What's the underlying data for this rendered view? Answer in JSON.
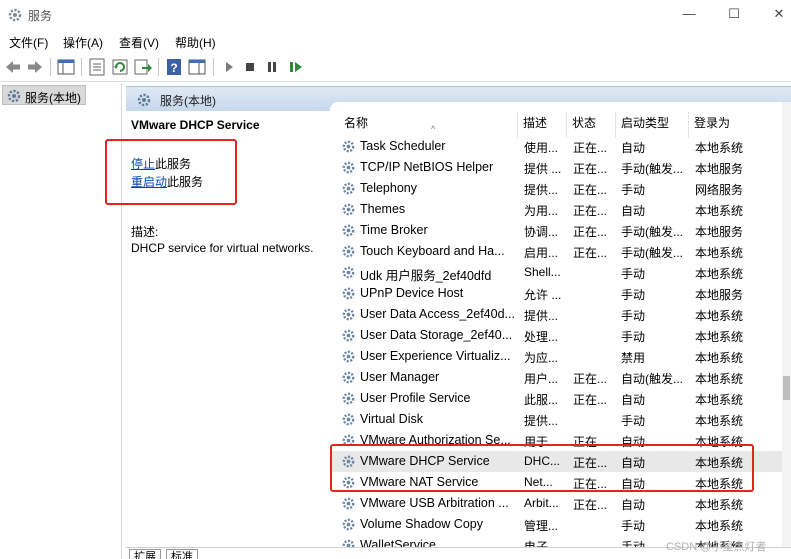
{
  "window": {
    "title": "服务",
    "minimize_glyph": "—",
    "maximize_glyph": "☐",
    "close_glyph": "✕"
  },
  "menu": [
    "文件(F)",
    "操作(A)",
    "查看(V)",
    "帮助(H)"
  ],
  "toolbar": {
    "icons": [
      "back-arrow-icon",
      "forward-arrow-icon",
      "console-tree-icon",
      "properties-icon",
      "refresh-icon",
      "export-list-icon",
      "help-icon",
      "show-hide-pane-icon",
      "start-service-icon",
      "stop-service-icon",
      "pause-service-icon",
      "restart-service-icon"
    ]
  },
  "tree": {
    "selected_label": "服务(本地)"
  },
  "pane_header": {
    "label": "服务(本地)"
  },
  "detail": {
    "service_title": "VMware DHCP Service",
    "stop_link": "停止",
    "stop_suffix": "此服务",
    "restart_link": "重启动",
    "restart_suffix": "此服务",
    "desc_label": "描述:",
    "desc_text": "DHCP service for virtual networks."
  },
  "columns": {
    "name": "名称",
    "desc": "描述",
    "status": "状态",
    "startup": "启动类型",
    "logon": "登录为",
    "sort_glyph": "^"
  },
  "services": [
    {
      "name": "Task Scheduler",
      "desc": "使用...",
      "status": "正在...",
      "startup": "自动",
      "logon": "本地系统"
    },
    {
      "name": "TCP/IP NetBIOS Helper",
      "desc": "提供 ...",
      "status": "正在...",
      "startup": "手动(触发...",
      "logon": "本地服务"
    },
    {
      "name": "Telephony",
      "desc": "提供...",
      "status": "正在...",
      "startup": "手动",
      "logon": "网络服务"
    },
    {
      "name": "Themes",
      "desc": "为用...",
      "status": "正在...",
      "startup": "自动",
      "logon": "本地系统"
    },
    {
      "name": "Time Broker",
      "desc": "协调...",
      "status": "正在...",
      "startup": "手动(触发...",
      "logon": "本地服务"
    },
    {
      "name": "Touch Keyboard and Ha...",
      "desc": "启用...",
      "status": "正在...",
      "startup": "手动(触发...",
      "logon": "本地系统"
    },
    {
      "name": "Udk 用户服务_2ef40dfd",
      "desc": "Shell...",
      "status": "",
      "startup": "手动",
      "logon": "本地系统"
    },
    {
      "name": "UPnP Device Host",
      "desc": "允许 ...",
      "status": "",
      "startup": "手动",
      "logon": "本地服务"
    },
    {
      "name": "User Data Access_2ef40d...",
      "desc": "提供...",
      "status": "",
      "startup": "手动",
      "logon": "本地系统"
    },
    {
      "name": "User Data Storage_2ef40...",
      "desc": "处理...",
      "status": "",
      "startup": "手动",
      "logon": "本地系统"
    },
    {
      "name": "User Experience Virtualiz...",
      "desc": "为应...",
      "status": "",
      "startup": "禁用",
      "logon": "本地系统"
    },
    {
      "name": "User Manager",
      "desc": "用户...",
      "status": "正在...",
      "startup": "自动(触发...",
      "logon": "本地系统"
    },
    {
      "name": "User Profile Service",
      "desc": "此服...",
      "status": "正在...",
      "startup": "自动",
      "logon": "本地系统"
    },
    {
      "name": "Virtual Disk",
      "desc": "提供...",
      "status": "",
      "startup": "手动",
      "logon": "本地系统"
    },
    {
      "name": "VMware Authorization Se...",
      "desc": "用于...",
      "status": "正在...",
      "startup": "自动",
      "logon": "本地系统"
    },
    {
      "name": "VMware DHCP Service",
      "desc": "DHC...",
      "status": "正在...",
      "startup": "自动",
      "logon": "本地系统"
    },
    {
      "name": "VMware NAT Service",
      "desc": "Net...",
      "status": "正在...",
      "startup": "自动",
      "logon": "本地系统"
    },
    {
      "name": "VMware USB Arbitration ...",
      "desc": "Arbit...",
      "status": "正在...",
      "startup": "自动",
      "logon": "本地系统"
    },
    {
      "name": "Volume Shadow Copy",
      "desc": "管理...",
      "status": "",
      "startup": "手动",
      "logon": "本地系统"
    },
    {
      "name": "WalletService",
      "desc": "电子...",
      "status": "",
      "startup": "手动",
      "logon": "本地系统"
    }
  ],
  "selected_service": "VMware DHCP Service",
  "tabs": [
    "扩展",
    "标准"
  ],
  "watermark": "CSDN @小星点灯者",
  "colors": {
    "highlight_box": "#e2261d",
    "link": "#0645ad",
    "header_bg": "#c7d8ec"
  }
}
